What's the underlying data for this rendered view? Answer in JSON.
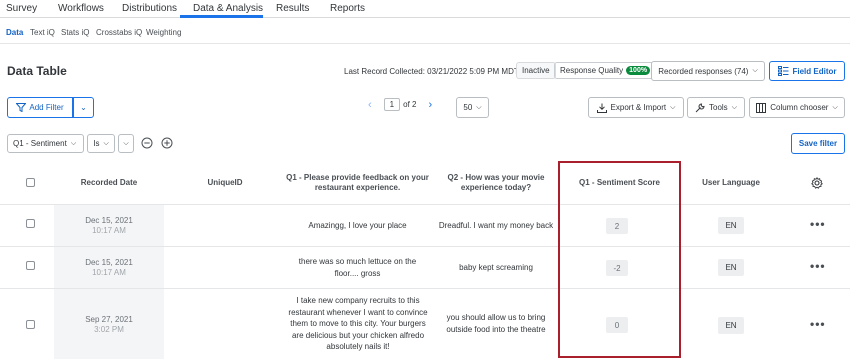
{
  "top_tabs": [
    "Survey",
    "Workflows",
    "Distributions",
    "Data & Analysis",
    "Results",
    "Reports"
  ],
  "sub_tabs": [
    "Data",
    "Text iQ",
    "Stats iQ",
    "Crosstabs iQ",
    "Weighting"
  ],
  "page_title": "Data Table",
  "header": {
    "last_record": "Last Record Collected: 03/21/2022 5:09 PM MDT",
    "status": "Inactive",
    "response_quality_label": "Response Quality",
    "response_quality_value": "100%",
    "recorded_responses": "Recorded responses (74)",
    "field_editor": "Field Editor"
  },
  "toolbar": {
    "add_filter": "Add Filter",
    "page_current": "1",
    "page_of": "of 2",
    "per_page": "50",
    "export_import": "Export & Import",
    "tools": "Tools",
    "column_chooser": "Column chooser"
  },
  "filter": {
    "field": "Q1 - Sentiment",
    "operator": "Is",
    "value": "",
    "save_filter": "Save filter"
  },
  "columns": {
    "recorded_date": "Recorded Date",
    "unique_id": "UniqueID",
    "q1": "Q1 - Please provide feedback on your restaurant experience.",
    "q2": "Q2 - How was your movie experience today?",
    "sentiment_score": "Q1 - Sentiment Score",
    "user_language": "User Language"
  },
  "rows": [
    {
      "date": "Dec 15, 2021",
      "time": "10:17 AM",
      "unique_id": "",
      "q1": "Amazingg, I love your place",
      "q2": "Dreadful. I want my money back",
      "score": "2",
      "language": "EN"
    },
    {
      "date": "Dec 15, 2021",
      "time": "10:17 AM",
      "unique_id": "",
      "q1": "there was so much lettuce on the floor.... gross",
      "q2": "baby kept screaming",
      "score": "-2",
      "language": "EN"
    },
    {
      "date": "Sep 27, 2021",
      "time": "3:02 PM",
      "unique_id": "",
      "q1": "I take new company recruits to this restaurant whenever I want to convince them to move to this city. Your burgers are delicious but your chicken alfredo absolutely nails it!",
      "q2": "you should allow us to bring outside food into the theatre",
      "score": "0",
      "language": "EN"
    }
  ],
  "colors": {
    "accent": "#1a73e8",
    "highlight": "#a91f2c",
    "quality_badge": "#0a8a3c"
  }
}
